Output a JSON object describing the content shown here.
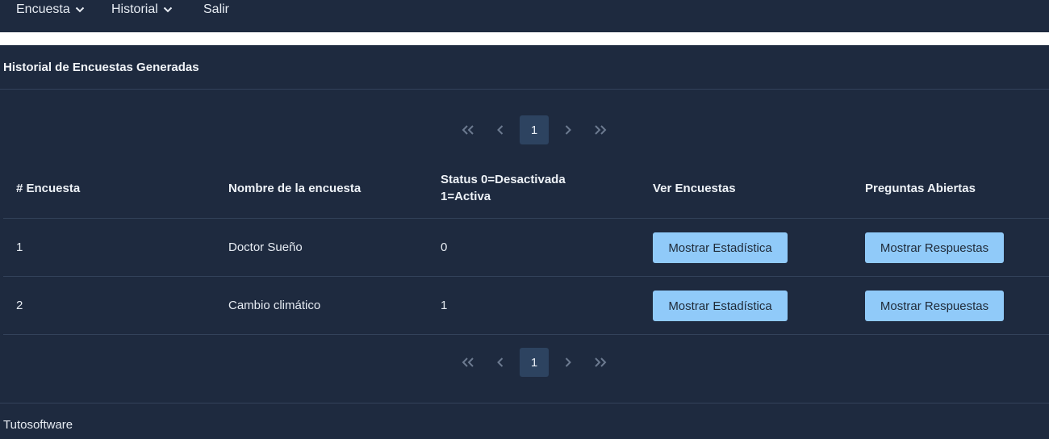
{
  "nav": {
    "items": [
      {
        "label": "Encuesta",
        "has_dropdown": true
      },
      {
        "label": "Historial",
        "has_dropdown": true
      },
      {
        "label": "Salir",
        "has_dropdown": false
      }
    ]
  },
  "card": {
    "title": "Historial de Encuestas Generadas"
  },
  "pagination": {
    "first": "«",
    "prev": "‹",
    "current": "1",
    "next": "›",
    "last": "»"
  },
  "table": {
    "headers": [
      "# Encuesta",
      "Nombre de la encuesta",
      "Status 0=Desactivada 1=Activa",
      "Ver Encuestas",
      "Preguntas Abiertas"
    ],
    "status_header_lines": [
      "Status 0=Desactivada",
      "1=Activa"
    ],
    "rows": [
      {
        "id": "1",
        "name": "Doctor Sueño",
        "status": "0",
        "stats_button": "Mostrar Estadística",
        "answers_button": "Mostrar Respuestas"
      },
      {
        "id": "2",
        "name": "Cambio climático",
        "status": "1",
        "stats_button": "Mostrar Estadística",
        "answers_button": "Mostrar Respuestas"
      }
    ]
  },
  "footer": {
    "text": "Tutosoftware"
  },
  "colors": {
    "background": "#1e2a3f",
    "button": "#90caf9",
    "active_page": "#2d4360"
  }
}
